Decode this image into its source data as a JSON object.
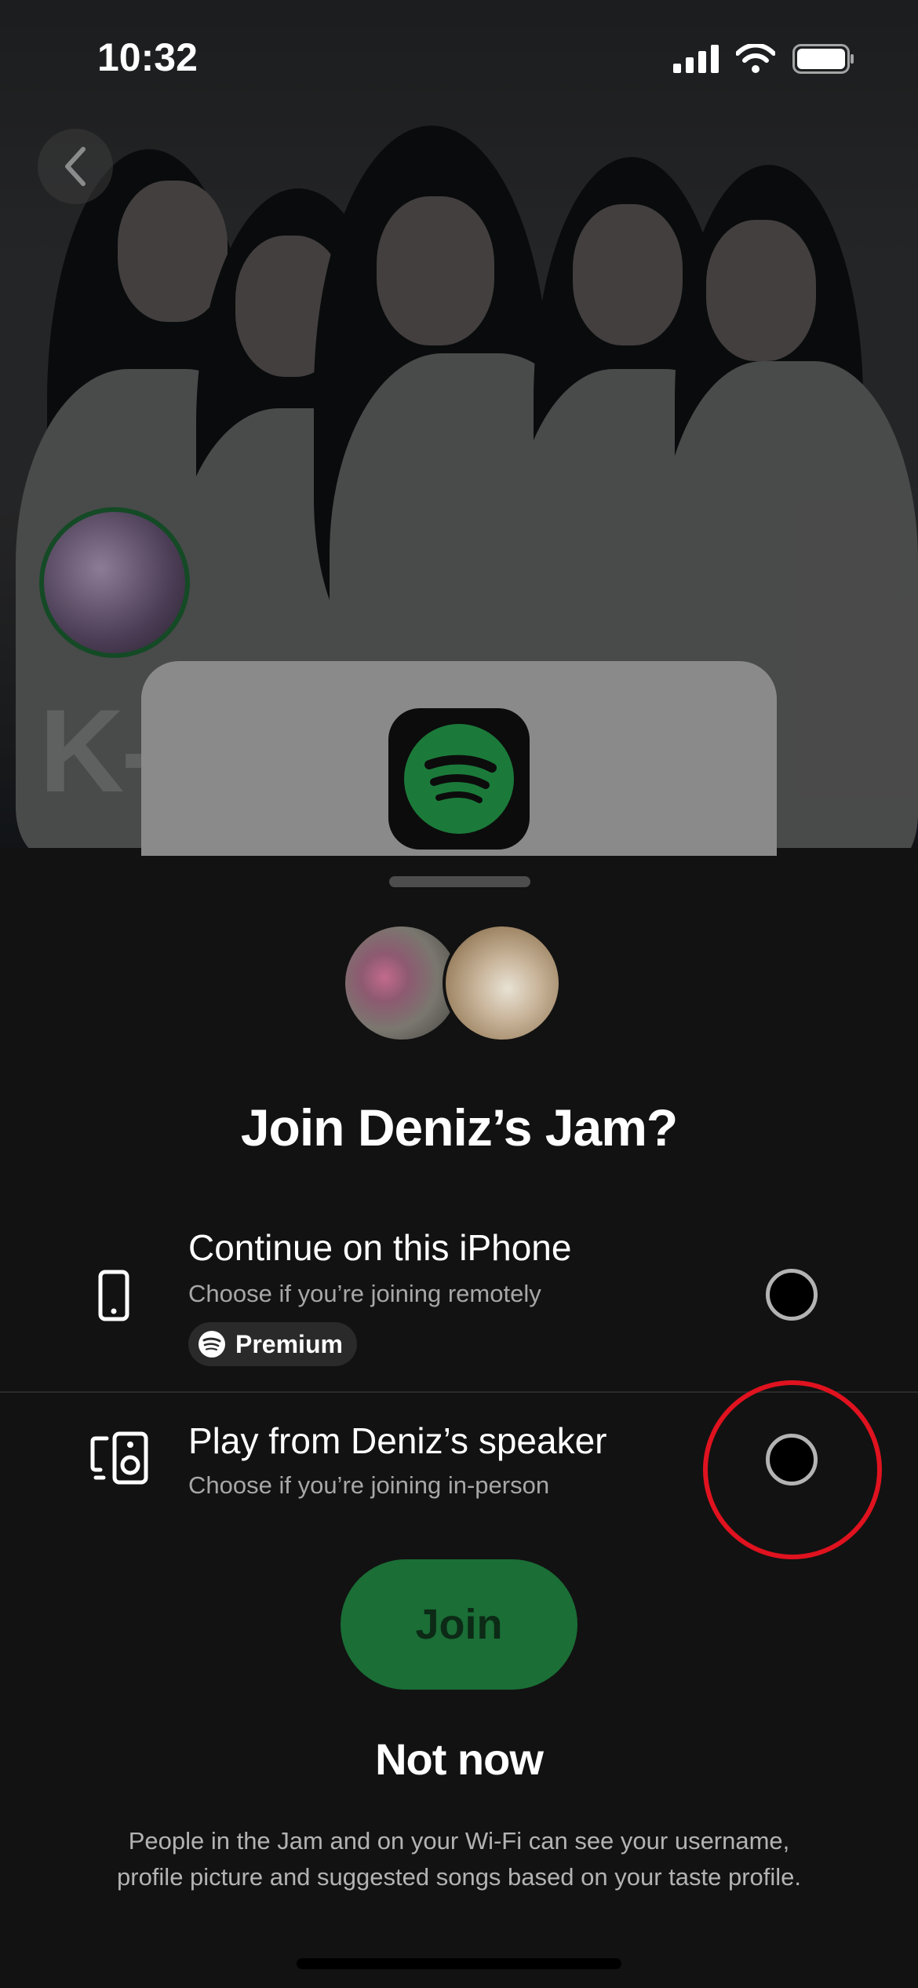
{
  "status_bar": {
    "time": "10:32",
    "icons": [
      "signal-icon",
      "wifi-icon",
      "battery-icon"
    ]
  },
  "background": {
    "visible_text": "K-",
    "icons": [
      "back-arrow-icon",
      "spotify-logo-icon"
    ]
  },
  "sheet": {
    "title": "Join Deniz’s Jam?",
    "options": [
      {
        "label": "Continue on this iPhone",
        "sublabel": "Choose if you’re joining remotely",
        "badge": "Premium",
        "icon": "phone-icon",
        "selected": false
      },
      {
        "label": "Play from Deniz’s speaker",
        "sublabel": "Choose if you’re joining in-person",
        "icon": "speaker-device-icon",
        "selected": false
      }
    ],
    "join_label": "Join",
    "not_now_label": "Not now",
    "disclaimer": "People in the Jam and on your Wi-Fi can see your username, profile picture and suggested songs based on your taste profile."
  },
  "colors": {
    "accent_green": "#1DB954",
    "join_button": "#1a6e36",
    "sheet_bg": "#121212",
    "highlight_ring": "#e0121f"
  }
}
